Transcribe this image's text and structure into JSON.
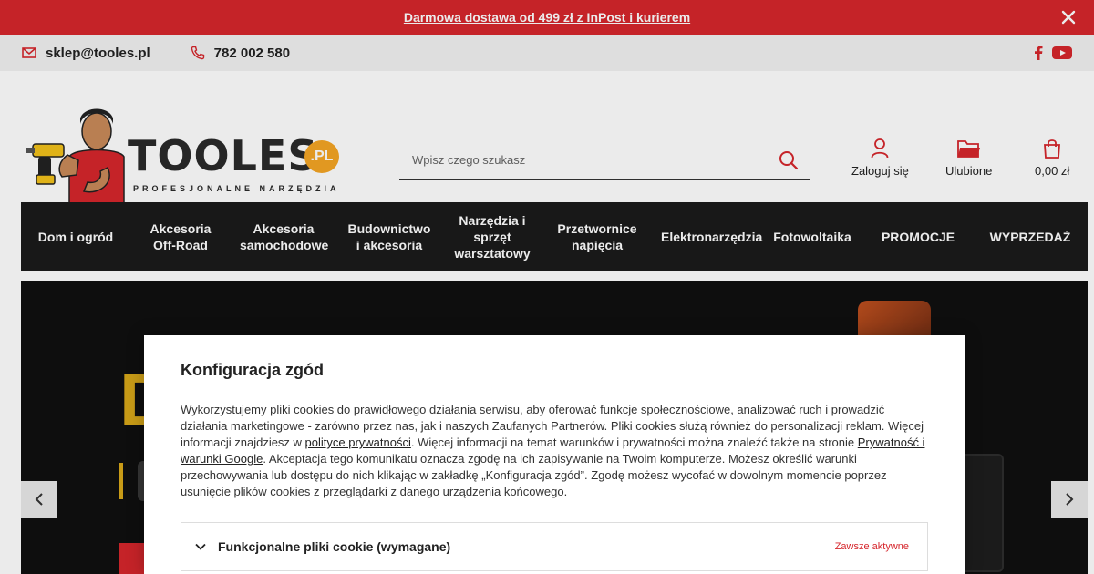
{
  "promo": {
    "text": "Darmowa dostawa od 499 zł z InPost i kurierem"
  },
  "contact": {
    "email": "sklep@tooles.pl",
    "phone": "782 002 580"
  },
  "logo": {
    "name": "TOOLES",
    "suffix": ".PL",
    "tagline": "PROFESJONALNE NARZĘDZIA"
  },
  "search": {
    "placeholder": "Wpisz czego szukasz"
  },
  "header_actions": {
    "login": "Zaloguj się",
    "favorites": "Ulubione",
    "cart": "0,00 zł"
  },
  "nav": {
    "items": [
      "Dom i ogród",
      "Akcesoria Off-Road",
      "Akcesoria samochodowe",
      "Budownictwo i akcesoria",
      "Narzędzia i sprzęt warsztatowy",
      "Przetwornice napięcia",
      "Elektronarzędzia",
      "Fotowoltaika",
      "PROMOCJE",
      "WYPRZEDAŻ"
    ]
  },
  "hero": {
    "visible_letter": "D"
  },
  "consent": {
    "title": "Konfiguracja zgód",
    "text_1": "Wykorzystujemy pliki cookies do prawidłowego działania serwisu, aby oferować funkcje społecznościowe, analizować ruch i prowadzić działania marketingowe - zarówno przez nas, jak i naszych Zaufanych Partnerów. Pliki cookies służą również do personalizacji reklam. Więcej informacji znajdziesz w ",
    "link_1": "polityce prywatności",
    "text_2": ". Więcej informacji na temat warunków i prywatności można znaleźć także na stronie ",
    "link_2": "Prywatność i warunki Google",
    "text_3": ". Akceptacja tego komunikatu oznacza zgodę na ich zapisywanie na Twoim komputerze. Możesz określić warunki przechowywania lub dostępu do nich klikając w zakładkę „Konfiguracja zgód”. Zgodę możesz wycofać w dowolnym momencie poprzez usunięcie plików cookies z przeglądarki z danego urządzenia końcowego.",
    "section_title": "Funkcjonalne pliki cookie (wymagane)",
    "section_status": "Zawsze aktywne"
  },
  "colors": {
    "brand_red": "#d6262c",
    "nav_bg": "#1b1b1b",
    "accent_orange": "#f5a524"
  },
  "icons": [
    "close-icon",
    "mail-icon",
    "phone-icon",
    "facebook-icon",
    "youtube-icon",
    "search-icon",
    "user-icon",
    "folder-icon",
    "bag-icon",
    "chevron-left-icon",
    "chevron-right-icon",
    "chevron-down-icon"
  ]
}
